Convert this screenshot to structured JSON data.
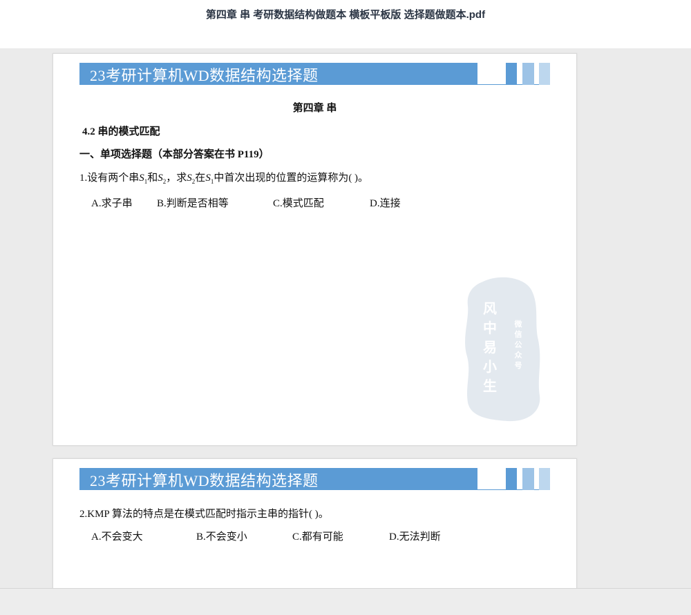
{
  "window": {
    "title": "第四章 串 考研数据结构做题本 横板平板版 选择题做题本.pdf"
  },
  "pages": [
    {
      "banner": "23考研计算机WD数据结构选择题",
      "chapter": "第四章  串",
      "section": "4.2  串的模式匹配",
      "part": "一、单项选择题（本部分答案在书 P119）",
      "question": {
        "prefix": "1.设有两个串",
        "s": "S",
        "sub1": "1",
        "sub2": "2",
        "and": "和",
        "comma_ask": "，求",
        "in": "在",
        "tail": "中首次出现的位置的运算称为(      )。"
      },
      "options": [
        "A.求子串",
        "B.判断是否相等",
        "C.模式匹配",
        "D.连接"
      ],
      "watermark": {
        "main": [
          "风",
          "中",
          "易",
          "小",
          "生"
        ],
        "side": [
          "微",
          "信",
          "公",
          "众",
          "号"
        ]
      }
    },
    {
      "banner": "23考研计算机WD数据结构选择题",
      "question": "2.KMP 算法的特点是在模式匹配时指示主串的指针(      )。",
      "options": [
        "A.不会变大",
        "B.不会变小",
        "C.都有可能",
        "D.无法判断"
      ]
    }
  ]
}
